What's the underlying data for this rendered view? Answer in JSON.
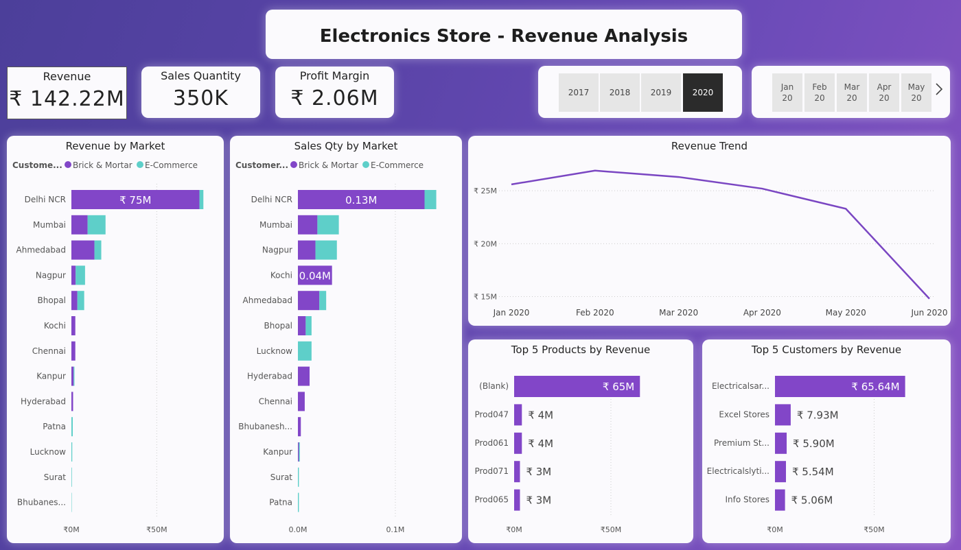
{
  "header": {
    "title": "Electronics Store - Revenue Analysis"
  },
  "kpis": [
    {
      "label": "Revenue",
      "value": "₹ 142.22M"
    },
    {
      "label": "Sales Quantity",
      "value": "350K"
    },
    {
      "label": "Profit Margin",
      "value": "₹ 2.06M"
    }
  ],
  "year_slicer": {
    "options": [
      "2017",
      "2018",
      "2019",
      "2020"
    ],
    "selected": "2020"
  },
  "month_slicer": {
    "options": [
      "Jan\n20",
      "Feb\n20",
      "Mar\n20",
      "Apr\n20",
      "May\n20"
    ],
    "next_icon": "chevron-right-icon"
  },
  "colors": {
    "brick": "#8246c8",
    "ecom": "#5ecfc9",
    "line": "#7a46c2"
  },
  "chart_data": [
    {
      "type": "bar",
      "orientation": "horizontal",
      "stacked": true,
      "title": "Revenue by Market",
      "legend": {
        "title": "Custome...",
        "items": [
          "Brick & Mortar",
          "E-Commerce"
        ]
      },
      "categories": [
        "Delhi NCR",
        "Mumbai",
        "Ahmedabad",
        "Nagpur",
        "Bhopal",
        "Kochi",
        "Chennai",
        "Kanpur",
        "Hyderabad",
        "Patna",
        "Lucknow",
        "Surat",
        "Bhubanes..."
      ],
      "series": [
        {
          "name": "Brick & Mortar",
          "values": [
            75,
            9.5,
            13.5,
            2.5,
            3.5,
            2.3,
            2.3,
            1.3,
            1.0,
            0,
            0,
            0,
            0
          ]
        },
        {
          "name": "E-Commerce",
          "values": [
            2.3,
            10.5,
            4.0,
            5.5,
            4.0,
            0,
            0,
            0.5,
            0,
            0.8,
            0.5,
            0.3,
            0.2
          ]
        }
      ],
      "data_labels": {
        "Delhi NCR": "₹ 75M"
      },
      "xlim": [
        0,
        80
      ],
      "xticks": [
        0,
        50
      ],
      "xtick_labels": [
        "₹0M",
        "₹50M"
      ]
    },
    {
      "type": "bar",
      "orientation": "horizontal",
      "stacked": true,
      "title": "Sales Qty by Market",
      "legend": {
        "title": "Customer...",
        "items": [
          "Brick & Mortar",
          "E-Commerce"
        ]
      },
      "categories": [
        "Delhi NCR",
        "Mumbai",
        "Nagpur",
        "Kochi",
        "Ahmedabad",
        "Bhopal",
        "Lucknow",
        "Hyderabad",
        "Chennai",
        "Bhubanesh...",
        "Kanpur",
        "Surat",
        "Patna"
      ],
      "series": [
        {
          "name": "Brick & Mortar",
          "values": [
            0.13,
            0.02,
            0.018,
            0.035,
            0.022,
            0.008,
            0,
            0.012,
            0.007,
            0.003,
            0.001,
            0,
            0
          ]
        },
        {
          "name": "E-Commerce",
          "values": [
            0.012,
            0.022,
            0.022,
            0,
            0.007,
            0.006,
            0.014,
            0,
            0,
            0,
            0.001,
            0.001,
            0.001
          ]
        }
      ],
      "data_labels": {
        "Delhi NCR": "0.13M",
        "Kochi": "0.04M"
      },
      "xlim": [
        0,
        0.155
      ],
      "xticks": [
        0,
        0.1
      ],
      "xtick_labels": [
        "0.0M",
        "0.1M"
      ]
    },
    {
      "type": "line",
      "title": "Revenue Trend",
      "x": [
        "Jan 2020",
        "Feb 2020",
        "Mar 2020",
        "Apr 2020",
        "May 2020",
        "Jun 2020"
      ],
      "values": [
        25.6,
        26.9,
        26.3,
        25.2,
        23.3,
        14.8
      ],
      "ylim": [
        14,
        27.6
      ],
      "yticks": [
        15,
        20,
        25
      ],
      "ytick_labels": [
        "₹ 15M",
        "₹ 20M",
        "₹ 25M"
      ]
    },
    {
      "type": "bar",
      "orientation": "horizontal",
      "title": "Top 5 Products by Revenue",
      "categories": [
        "(Blank)",
        "Prod047",
        "Prod061",
        "Prod071",
        "Prod065"
      ],
      "values": [
        65,
        4,
        4,
        3,
        3
      ],
      "value_labels": [
        "₹ 65M",
        "₹ 4M",
        "₹ 4M",
        "₹ 3M",
        "₹ 3M"
      ],
      "xlim": [
        0,
        72
      ],
      "xticks": [
        0,
        50
      ],
      "xtick_labels": [
        "₹0M",
        "₹50M"
      ]
    },
    {
      "type": "bar",
      "orientation": "horizontal",
      "title": "Top 5 Customers by Revenue",
      "categories": [
        "Electricalsar...",
        "Excel Stores",
        "Premium St...",
        "Electricalslyti...",
        "Info Stores"
      ],
      "values": [
        65.64,
        7.93,
        5.9,
        5.54,
        5.06
      ],
      "value_labels": [
        "₹ 65.64M",
        "₹ 7.93M",
        "₹ 5.90M",
        "₹ 5.54M",
        "₹ 5.06M"
      ],
      "xlim": [
        0,
        72
      ],
      "xticks": [
        0,
        50
      ],
      "xtick_labels": [
        "₹0M",
        "₹50M"
      ]
    }
  ]
}
